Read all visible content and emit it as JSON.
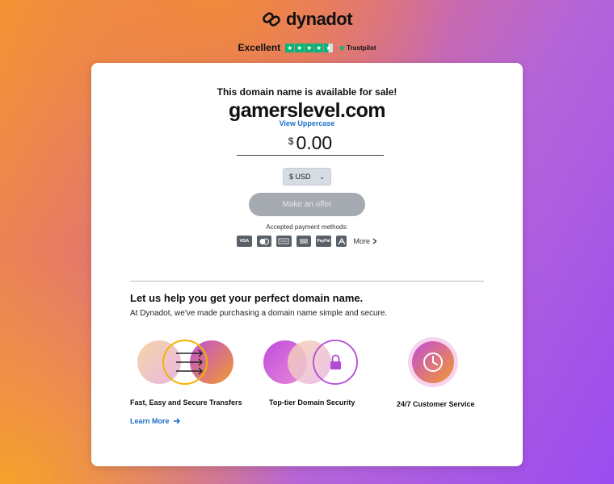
{
  "brand": {
    "name": "dynadot"
  },
  "trustpilot": {
    "label": "Excellent",
    "provider": "Trustpilot",
    "rating": 4.5,
    "max": 5
  },
  "listing": {
    "headline": "This domain name is available for sale!",
    "domain": "gamerslevel.com",
    "view_uppercase": "View Uppercase",
    "currency_symbol": "$",
    "price": "0.00",
    "currency_option": "$ USD",
    "offer_button": "Make an offer",
    "payment_label": "Accepted payment methods:",
    "payment_methods": [
      "VISA",
      "MC",
      "AMEX",
      "BANK",
      "PayPal",
      "ALIPAY"
    ],
    "more_label": "More"
  },
  "help": {
    "title": "Let us help you get your perfect domain name.",
    "subtitle": "At Dynadot, we've made purchasing a domain name simple and secure.",
    "features": [
      {
        "label": "Fast, Easy and Secure Transfers"
      },
      {
        "label": "Top-tier Domain Security"
      },
      {
        "label": "24/7 Customer Service"
      }
    ],
    "learn_more": "Learn More"
  },
  "colors": {
    "accent_link": "#1a6fc9",
    "trustpilot_green": "#00b67a",
    "button_disabled": "#a6abb2"
  }
}
